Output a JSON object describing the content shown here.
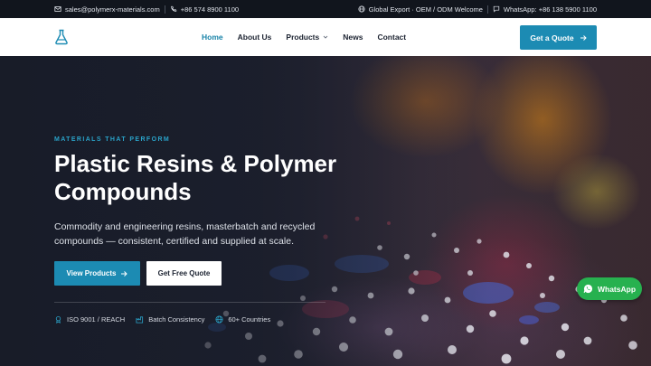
{
  "topbar": {
    "email": "sales@polymerx-materials.com",
    "phone": "+86 574 8900 1100",
    "export": "Global Export · OEM / ODM Welcome",
    "whatsapp": "WhatsApp: +86 138 5900 1100"
  },
  "nav": {
    "items": [
      {
        "label": "Home",
        "active": true
      },
      {
        "label": "About Us",
        "active": false
      },
      {
        "label": "Products",
        "active": false,
        "dropdown": true
      },
      {
        "label": "News",
        "active": false
      },
      {
        "label": "Contact",
        "active": false
      }
    ],
    "cta_label": "Get a Quote"
  },
  "hero": {
    "eyebrow": "MATERIALS THAT PERFORM",
    "title": "Plastic Resins & Polymer Compounds",
    "subtitle": "Commodity and engineering resins, masterbatch and recycled compounds — consistent, certified and supplied at scale.",
    "primary_button": "View Products",
    "secondary_button": "Get Free Quote",
    "badges": [
      {
        "label": "ISO 9001 / REACH",
        "icon": "certificate-icon"
      },
      {
        "label": "Batch Consistency",
        "icon": "factory-icon"
      },
      {
        "label": "60+ Countries",
        "icon": "globe-icon"
      }
    ]
  },
  "whatsapp_button": "WhatsApp",
  "colors": {
    "accent": "#1c8bb3",
    "topbar_bg": "#11151d",
    "whatsapp_green": "#27b14f"
  }
}
